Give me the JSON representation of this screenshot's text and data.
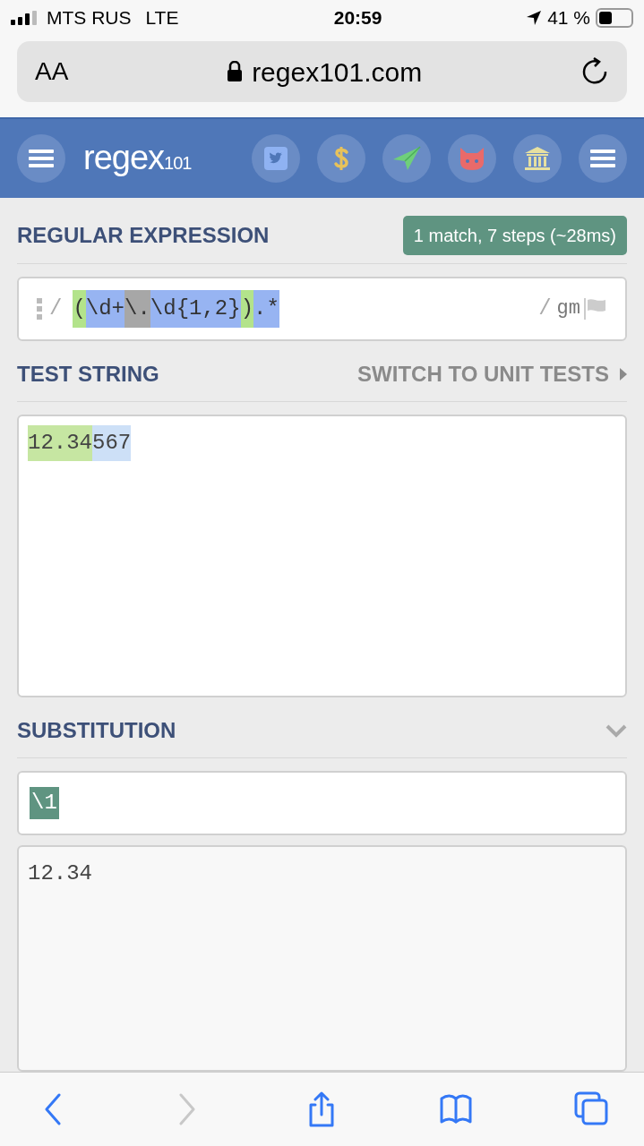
{
  "status_bar": {
    "carrier": "MTS RUS",
    "network": "LTE",
    "time": "20:59",
    "battery_percent": "41 %"
  },
  "browser": {
    "text_size": "AA",
    "url": "regex101.com"
  },
  "header": {
    "logo": "regex",
    "logo_suffix": "101",
    "icons": [
      {
        "kind": "twitter"
      },
      {
        "kind": "dollar"
      },
      {
        "kind": "plane"
      },
      {
        "kind": "github"
      },
      {
        "kind": "bank"
      },
      {
        "kind": "menu"
      }
    ]
  },
  "regex": {
    "title": "REGULAR EXPRESSION",
    "badge": "1 match, 7 steps (~28ms)",
    "delimiter": "/",
    "flags_delimiter": "/",
    "flags": "gm",
    "tokens": [
      {
        "text": "(",
        "color": "#b3e38b"
      },
      {
        "text": "\\d+",
        "color": "#97b4f2"
      },
      {
        "text": "\\.",
        "color": "#a7a7a7"
      },
      {
        "text": "\\d{1,2}",
        "color": "#97b4f2"
      },
      {
        "text": ")",
        "color": "#b3e38b"
      },
      {
        "text": ".*",
        "color": "#97b4f2"
      }
    ]
  },
  "test_string": {
    "title": "TEST STRING",
    "switch_link": "SWITCH TO UNIT TESTS",
    "segments": [
      {
        "text": "12.34",
        "color": "#c6e6a2"
      },
      {
        "text": "567",
        "color": "#cde0f7"
      }
    ]
  },
  "substitution": {
    "title": "SUBSTITUTION",
    "expanded": true,
    "value": "\\1",
    "result": "12.34"
  },
  "toolbar": [
    {
      "kind": "back",
      "disabled": false
    },
    {
      "kind": "forward",
      "disabled": true
    },
    {
      "kind": "share",
      "disabled": false
    },
    {
      "kind": "bookmarks",
      "disabled": false
    },
    {
      "kind": "tabs",
      "disabled": false
    }
  ]
}
